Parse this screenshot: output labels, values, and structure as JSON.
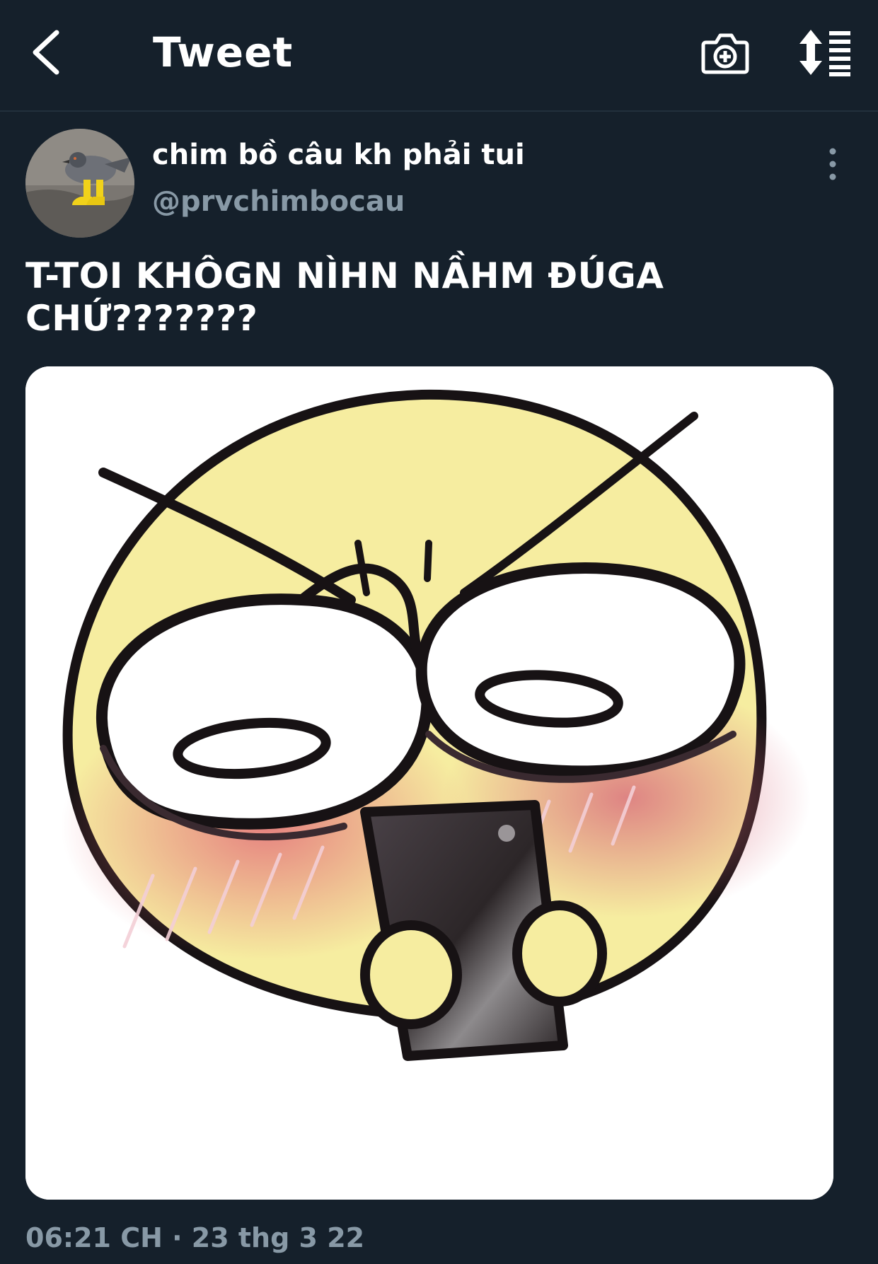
{
  "header": {
    "title": "Tweet",
    "back_icon": "chevron-left-icon",
    "camera_icon": "camera-add-icon",
    "sort_icon": "sort-list-icon"
  },
  "tweet": {
    "display_name": "chim bồ câu kh phải tui",
    "handle": "@prvchimbocau",
    "text_line1": "T-TOI KHÔGN NÌHN NẦHM ĐÚGA",
    "text_line2": "CHỨ???????",
    "timestamp": "06:21 CH · 23 thg 3 22",
    "more_icon": "more-vertical-icon"
  },
  "colors": {
    "background": "#15202b",
    "secondary_text": "#8899a6",
    "emoji_yellow": "#f6eda0",
    "blush": "#e88a8a"
  }
}
